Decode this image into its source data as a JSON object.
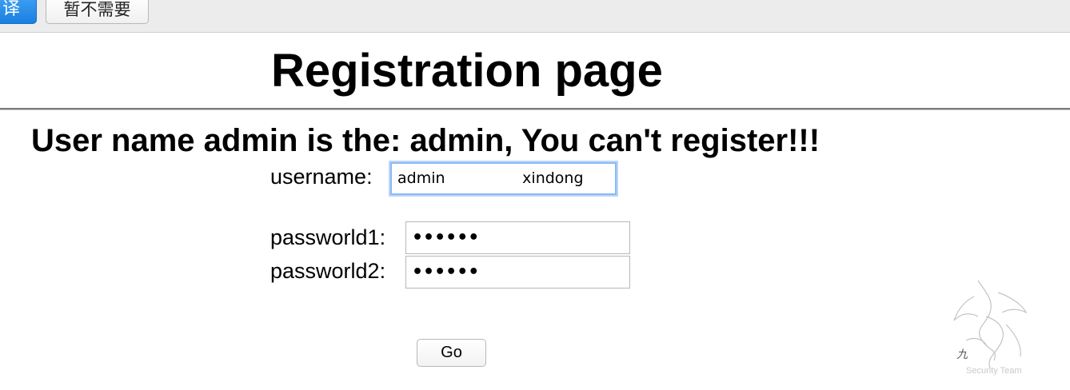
{
  "translate_bar": {
    "translate_label": "译",
    "dismiss_label": "暂不需要"
  },
  "page": {
    "title": "Registration page",
    "error_message": "User name admin is the: admin, You can't register!!!"
  },
  "form": {
    "username_label": "username:",
    "username_value": "admin                xindong",
    "password1_label": "passworld1:",
    "password1_value": "••••••",
    "password2_label": "passworld2:",
    "password2_value": "••••••",
    "submit_label": "Go"
  },
  "watermark": {
    "text": "Security Team",
    "icon": "dragon-logo"
  }
}
